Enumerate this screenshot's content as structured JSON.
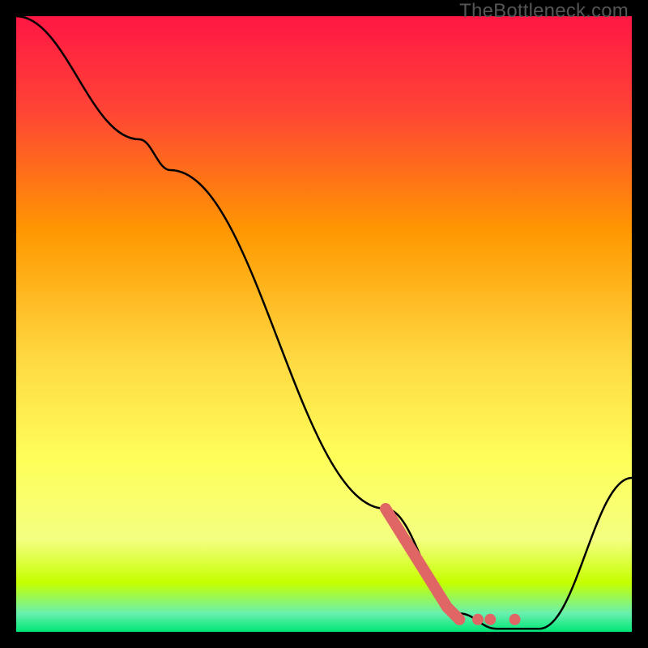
{
  "watermark": "TheBottleneck.com",
  "chart_data": {
    "type": "line",
    "title": "",
    "xlabel": "",
    "ylabel": "",
    "xlim": [
      0,
      100
    ],
    "ylim": [
      0,
      100
    ],
    "gradient_stops": [
      {
        "offset": 0,
        "color": "#ff1744"
      },
      {
        "offset": 15,
        "color": "#ff4336"
      },
      {
        "offset": 35,
        "color": "#ff9800"
      },
      {
        "offset": 55,
        "color": "#ffd740"
      },
      {
        "offset": 72,
        "color": "#ffff59"
      },
      {
        "offset": 85,
        "color": "#f4ff81"
      },
      {
        "offset": 92,
        "color": "#c6ff00"
      },
      {
        "offset": 97,
        "color": "#69f0ae"
      },
      {
        "offset": 100,
        "color": "#00e676"
      }
    ],
    "series": [
      {
        "name": "bottleneck-curve",
        "color": "#000000",
        "points": [
          {
            "x": 0,
            "y": 100
          },
          {
            "x": 20,
            "y": 80
          },
          {
            "x": 25,
            "y": 75
          },
          {
            "x": 60,
            "y": 20
          },
          {
            "x": 72,
            "y": 3
          },
          {
            "x": 78,
            "y": 0.5
          },
          {
            "x": 85,
            "y": 0.5
          },
          {
            "x": 100,
            "y": 25
          }
        ]
      }
    ],
    "highlight": {
      "color": "#e06666",
      "segment": [
        {
          "x": 60,
          "y": 20
        },
        {
          "x": 70,
          "y": 4
        },
        {
          "x": 72,
          "y": 2
        }
      ],
      "dots": [
        {
          "x": 72,
          "y": 2
        },
        {
          "x": 75,
          "y": 2
        },
        {
          "x": 77,
          "y": 2
        },
        {
          "x": 81,
          "y": 2
        }
      ]
    }
  }
}
